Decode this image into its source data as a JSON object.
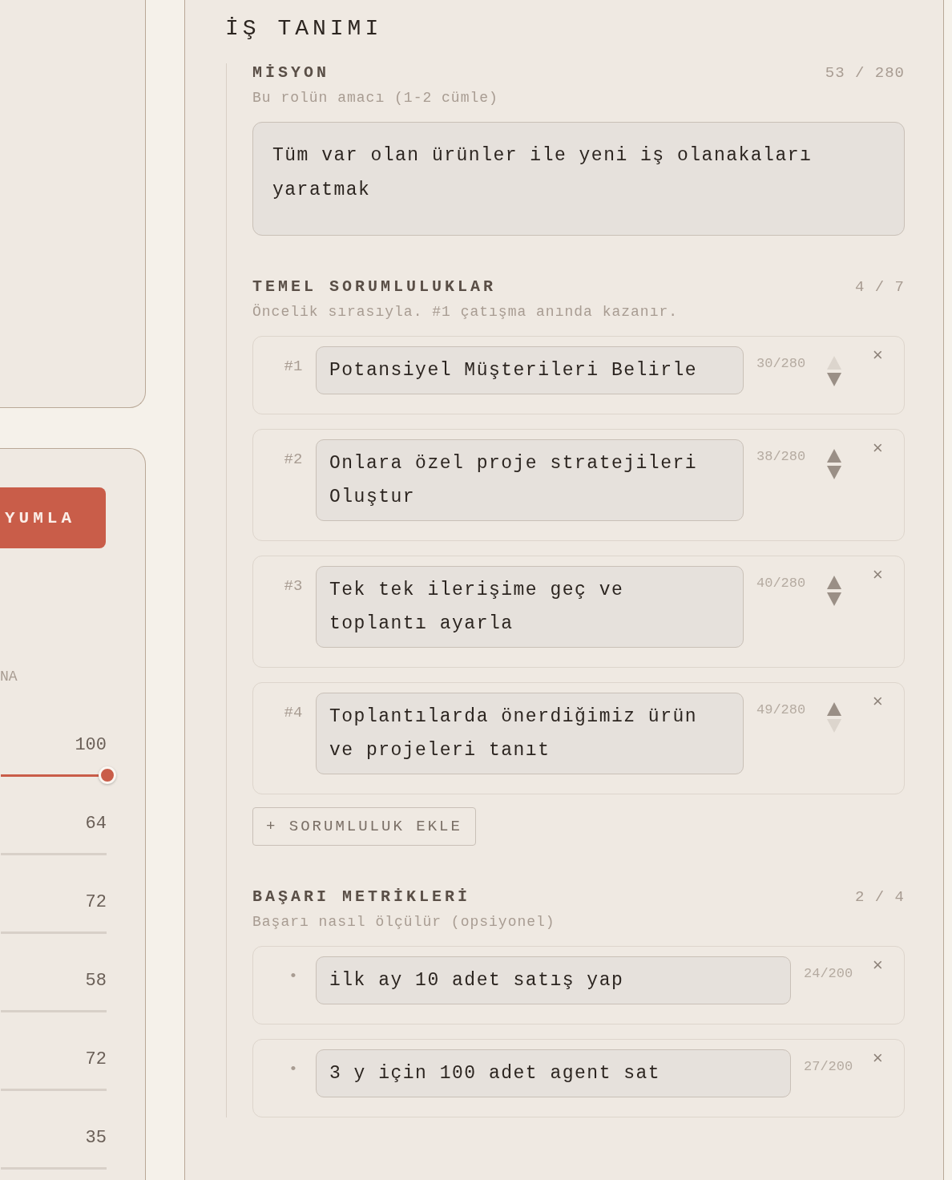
{
  "left_panel": {
    "button": "YUMLA",
    "label": "NA",
    "sliders": [
      {
        "value": "100",
        "active": true
      },
      {
        "value": "64",
        "active": false
      },
      {
        "value": "72",
        "active": false
      },
      {
        "value": "58",
        "active": false
      },
      {
        "value": "72",
        "active": false
      },
      {
        "value": "35",
        "active": false
      }
    ]
  },
  "main": {
    "title": "İŞ TANIMI",
    "mission": {
      "label": "MİSYON",
      "count": "53 / 280",
      "hint": "Bu rolün amacı (1-2 cümle)",
      "value": "Tüm var olan ürünler ile yeni iş olanakaları yaratmak"
    },
    "responsibilities": {
      "label": "TEMEL SORUMLULUKLAR",
      "count": "4 / 7",
      "hint": "Öncelik sırasıyla. #1 çatışma anında kazanır.",
      "items": [
        {
          "number": "#1",
          "value": "Potansiyel Müşterileri Belirle",
          "count": "30/280",
          "can_move_up": false,
          "can_move_down": true,
          "remove": "×"
        },
        {
          "number": "#2",
          "value": "Onlara özel proje stratejileri Oluştur",
          "count": "38/280",
          "can_move_up": true,
          "can_move_down": true,
          "remove": "×"
        },
        {
          "number": "#3",
          "value": "Tek tek ilerişime geç ve toplantı ayarla",
          "count": "40/280",
          "can_move_up": true,
          "can_move_down": true,
          "remove": "×"
        },
        {
          "number": "#4",
          "value": "Toplantılarda önerdiğimiz ürün ve projeleri tanıt",
          "count": "49/280",
          "can_move_up": true,
          "can_move_down": false,
          "remove": "×"
        }
      ],
      "add_button": "+ SORUMLULUK EKLE"
    },
    "metrics": {
      "label": "BAŞARI METRİKLERİ",
      "count": "2 / 4",
      "hint": "Başarı nasıl ölçülür (opsiyonel)",
      "items": [
        {
          "bullet": "•",
          "value": "ilk ay 10 adet satış yap",
          "count": "24/200",
          "remove": "×"
        },
        {
          "bullet": "•",
          "value": "3 y için 100 adet agent sat",
          "count": "27/200",
          "remove": "×"
        }
      ]
    }
  }
}
